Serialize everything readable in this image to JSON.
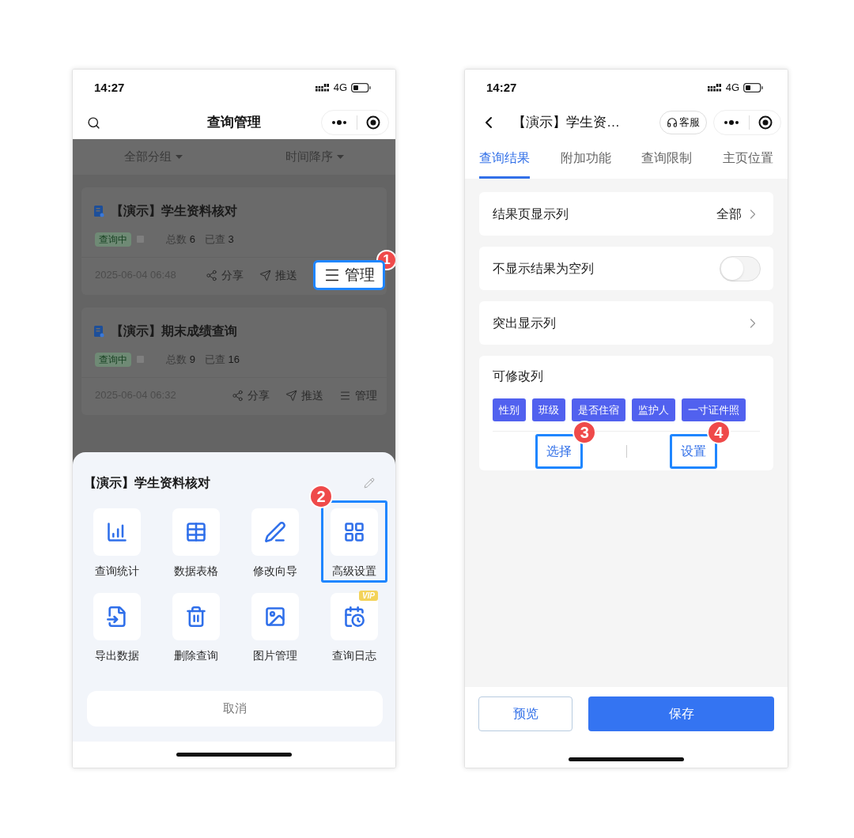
{
  "left_phone": {
    "status_bar": {
      "time": "14:27",
      "network": "4G"
    },
    "nav": {
      "title": "查询管理"
    },
    "dimmed": true,
    "filters": [
      {
        "label": "全部分组"
      },
      {
        "label": "时间降序"
      }
    ],
    "cards": [
      {
        "title": "【演示】学生资料核对",
        "status": "查询中",
        "total_label": "总数",
        "total": "6",
        "checked_label": "已查",
        "checked": "3",
        "date": "2025-06-04 06:48",
        "actions": [
          {
            "kind": "share",
            "label": "分享",
            "highlighted": false
          },
          {
            "kind": "send",
            "label": "推送",
            "highlighted": false
          },
          {
            "kind": "manage",
            "label": "管理",
            "highlighted": true,
            "step": "1"
          }
        ]
      },
      {
        "title": "【演示】期末成绩查询",
        "status": "查询中",
        "total_label": "总数",
        "total": "9",
        "checked_label": "已查",
        "checked": "16",
        "date": "2025-06-04 06:32",
        "actions": [
          {
            "kind": "share",
            "label": "分享",
            "highlighted": false
          },
          {
            "kind": "send",
            "label": "推送",
            "highlighted": false
          },
          {
            "kind": "manage",
            "label": "管理",
            "highlighted": false
          }
        ]
      }
    ],
    "sheet": {
      "title": "【演示】学生资料核对",
      "items": [
        {
          "kind": "stats",
          "label": "查询统计",
          "highlighted": false
        },
        {
          "kind": "table",
          "label": "数据表格",
          "highlighted": false
        },
        {
          "kind": "edit",
          "label": "修改向导",
          "highlighted": false
        },
        {
          "kind": "advanced",
          "label": "高级设置",
          "highlighted": true,
          "step": "2"
        },
        {
          "kind": "export",
          "label": "导出数据",
          "highlighted": false
        },
        {
          "kind": "delete",
          "label": "删除查询",
          "highlighted": false
        },
        {
          "kind": "image",
          "label": "图片管理",
          "highlighted": false
        },
        {
          "kind": "log",
          "label": "查询日志",
          "highlighted": false,
          "badge": "VIP"
        }
      ],
      "cancel": "取消"
    }
  },
  "right_phone": {
    "status_bar": {
      "time": "14:27",
      "network": "4G"
    },
    "nav": {
      "title": "【演示】学生资…",
      "service": "客服"
    },
    "tabs": [
      {
        "label": "查询结果",
        "selected": true
      },
      {
        "label": "附加功能",
        "selected": false
      },
      {
        "label": "查询限制",
        "selected": false
      },
      {
        "label": "主页位置",
        "selected": false
      }
    ],
    "rows": [
      {
        "kind": "link",
        "label": "结果页显示列",
        "value": "全部"
      },
      {
        "kind": "toggle",
        "label": "不显示结果为空列",
        "on": false
      },
      {
        "kind": "link",
        "label": "突出显示列"
      }
    ],
    "editable": {
      "title": "可修改列",
      "tags": [
        "性别",
        "班级",
        "是否住宿",
        "监护人",
        "一寸证件照"
      ],
      "actions": [
        {
          "label": "选择",
          "highlighted": true,
          "step": "3"
        },
        {
          "label": "设置",
          "highlighted": true,
          "step": "4"
        }
      ]
    },
    "buttons": {
      "preview": "预览",
      "save": "保存"
    }
  }
}
